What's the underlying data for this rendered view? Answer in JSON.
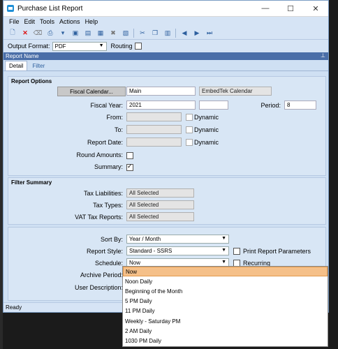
{
  "window": {
    "title": "Purchase List Report"
  },
  "window_controls": {
    "minimize": "—",
    "maximize": "☐",
    "close": "✕"
  },
  "menu": [
    "File",
    "Edit",
    "Tools",
    "Actions",
    "Help"
  ],
  "output": {
    "label": "Output Format:",
    "format_value": "PDF",
    "routing_label": "Routing",
    "routing_checked": false
  },
  "pane": {
    "title": "Report Name",
    "tabs": [
      "Detail",
      "Filter"
    ],
    "active_tab": "Detail"
  },
  "report_options": {
    "title": "Report Options",
    "fiscal_calendar_button": "Fiscal Calendar...",
    "fiscal_calendar_value": "Main",
    "calendar_name": "EmbedTek Calendar",
    "fiscal_year_label": "Fiscal Year:",
    "fiscal_year_value": "2021",
    "period_label": "Period:",
    "period_value": "8",
    "from_label": "From:",
    "to_label": "To:",
    "report_date_label": "Report Date:",
    "dynamic_label": "Dynamic",
    "round_amounts_label": "Round Amounts:",
    "round_amounts_checked": false,
    "summary_label": "Summary:",
    "summary_checked": true
  },
  "filter_summary": {
    "title": "Filter Summary",
    "tax_liabilities_label": "Tax Liabilities:",
    "tax_liabilities_value": "All Selected",
    "tax_types_label": "Tax Types:",
    "tax_types_value": "All Selected",
    "vat_tax_reports_label": "VAT Tax Reports:",
    "vat_tax_reports_value": "All Selected"
  },
  "output_options": {
    "sort_by_label": "Sort By:",
    "sort_by_value": "Year / Month",
    "report_style_label": "Report Style:",
    "report_style_value": "Standard - SSRS",
    "print_params_label": "Print Report Parameters",
    "schedule_label": "Schedule:",
    "schedule_value": "Now",
    "recurring_label": "Recurring",
    "archive_period_label": "Archive Period:",
    "user_description_label": "User Description:"
  },
  "schedule_options": [
    "Now",
    "Noon Daily",
    "Beginning of the Month",
    "5 PM Daily",
    "11 PM Daily",
    "Weekly - Saturday PM",
    "2 AM Daily",
    "1030 PM Daily"
  ],
  "schedule_selected": "Now",
  "status": {
    "text": "Ready"
  }
}
